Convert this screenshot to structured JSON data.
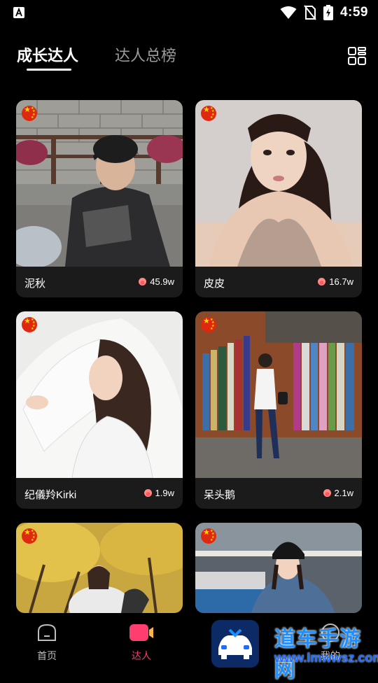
{
  "status_bar": {
    "time": "4:59",
    "icons": [
      "app-notification-icon",
      "wifi-icon",
      "no-sim-icon",
      "battery-charging-icon"
    ]
  },
  "header": {
    "tabs": [
      {
        "label": "成长达人",
        "active": true
      },
      {
        "label": "达人总榜",
        "active": false
      }
    ],
    "toggle_icon": "grid-view-icon"
  },
  "cards": [
    {
      "name": "泥秋",
      "heat": "45.9w",
      "photo": "young man sitting by stone wall"
    },
    {
      "name": "皮皮",
      "heat": "16.7w",
      "photo": "woman selfie"
    },
    {
      "name": "纪儀羚Kirki",
      "heat": "1.9w",
      "photo": "woman with white veil"
    },
    {
      "name": "呆头鹅",
      "heat": "2.1w",
      "photo": "woman by bookshelf mural"
    },
    {
      "name": "",
      "heat": "",
      "photo": "woman under yellow tree"
    },
    {
      "name": "",
      "heat": "",
      "photo": "woman in parking garage"
    }
  ],
  "bottom_nav": {
    "items": [
      {
        "label": "首页",
        "icon": "home-icon",
        "active": false
      },
      {
        "label": "达人",
        "icon": "video-camera-icon",
        "active": true
      },
      {
        "label": "我的",
        "icon": "profile-icon",
        "active": false
      }
    ]
  },
  "watermark": {
    "title": "道车手游网",
    "url": "www.lmwwsz.com"
  },
  "colors": {
    "background": "#000000",
    "card": "#1b1b1b",
    "accent": "#ff3d6e",
    "flag_red": "#de2910",
    "flag_yellow": "#ffde00"
  }
}
